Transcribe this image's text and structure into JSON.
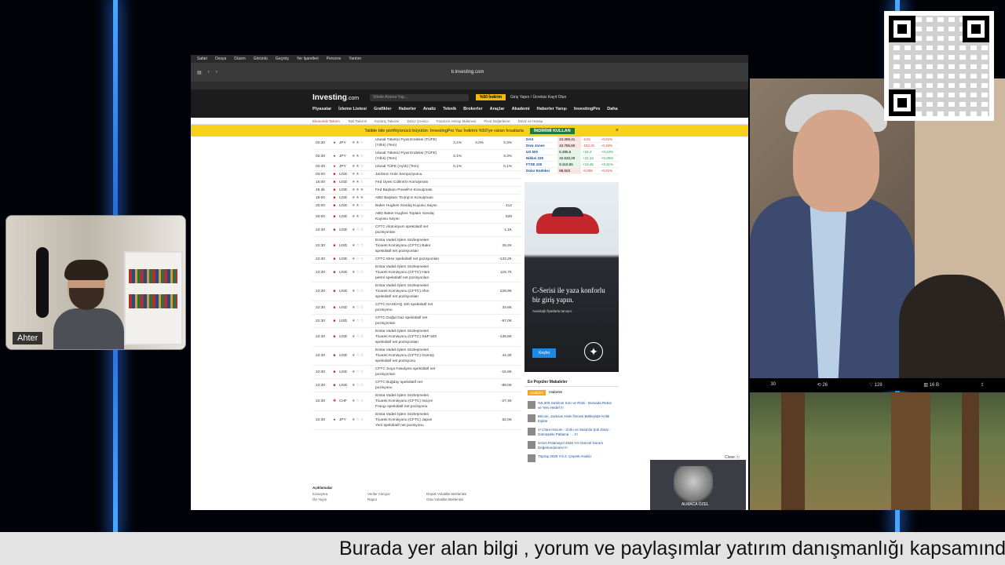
{
  "browser": {
    "url": "tr.investing.com",
    "menubar": [
      "Safari",
      "Dosya",
      "Düzen",
      "Görüntü",
      "Geçmiş",
      "Yer İşaretleri",
      "Pencere",
      "Yardım"
    ]
  },
  "site": {
    "logo": "Investing",
    "logo_suffix": ".com",
    "search_placeholder": "Sitede Arama Yap...",
    "promo_label": "%50 İndirim",
    "login_label": "Giriş Yapın / Ücretsiz Kayıt Olun",
    "nav": [
      "Piyasalar",
      "İzleme Listesi",
      "Grafikler",
      "Haberler",
      "Analiz",
      "Teknik",
      "Brokerler",
      "Araçlar",
      "Akademi",
      "Haberler Yarışı",
      "InvestingPro",
      "Daha"
    ],
    "subnav": [
      "Ekonomik Takvim",
      "Tatil Takvimi",
      "Kazanç Takvimi",
      "Döviz Çevirici",
      "Faizsizin Hesap Makinesi",
      "Pivot Değerleme",
      "Döviz ve Hesap"
    ]
  },
  "banner": {
    "text": "Tatilde bile portföyünüzü büyütün: InvestingPro Yaz İndirimi %50'ye varan fırsatlarla",
    "cta": "İNDİRİMİ KULLAN",
    "close": "×"
  },
  "calendar": [
    {
      "time": "02:30",
      "flag": "●",
      "cur": "JPY",
      "stars": "★★☆",
      "event": "Ulusal Tüketici Fiyat Endeksi (TÜFE) (Yıllık) (Tem)",
      "actual": "3,1%",
      "forecast": "3,0%",
      "prev": "3,3%"
    },
    {
      "time": "02:30",
      "flag": "●",
      "cur": "JPY",
      "stars": "★★☆",
      "event": "Ulusal Tüketici Fiyat Endeksi (TÜFE) (Yıllık) (Tem)",
      "actual": "3,1%",
      "forecast": "",
      "prev": "3,3%"
    },
    {
      "time": "02:30",
      "flag": "●",
      "cur": "JPY",
      "stars": "★★☆",
      "event": "Ulusal TÜFE (Aylık) (Tem)",
      "actual": "0,1%",
      "forecast": "",
      "prev": "0,1%"
    },
    {
      "time": "03:00",
      "flag": "■",
      "cur": "USD",
      "stars": "★★☆",
      "event": "Jackson Hole Sempozyumu",
      "actual": "",
      "forecast": "",
      "prev": ""
    },
    {
      "time": "16:00",
      "flag": "■",
      "cur": "USD",
      "stars": "★★☆",
      "event": "Fed Üyesi Collins'in Konuşması",
      "actual": "",
      "forecast": "",
      "prev": ""
    },
    {
      "time": "45 dk",
      "flag": "■",
      "cur": "USD",
      "stars": "★★★",
      "event": "Fed Başkanı Powell'ın Konuşması",
      "actual": "",
      "forecast": "",
      "prev": ""
    },
    {
      "time": "19:00",
      "flag": "■",
      "cur": "USD",
      "stars": "★★★",
      "event": "ABD Başkanı Trump'ın Konuşması",
      "actual": "",
      "forecast": "",
      "prev": ""
    },
    {
      "time": "20:00",
      "flag": "■",
      "cur": "USD",
      "stars": "★★☆",
      "event": "Baker Hughes Sondaj Kuyusu Sayısı",
      "actual": "",
      "forecast": "",
      "prev": "412"
    },
    {
      "time": "20:00",
      "flag": "■",
      "cur": "USD",
      "stars": "★★☆",
      "event": "ABD Baker Hughes Toplam Sondaj Kuyusu Sayısı",
      "actual": "",
      "forecast": "",
      "prev": "539"
    },
    {
      "time": "22:30",
      "flag": "■",
      "cur": "USD",
      "stars": "★☆☆",
      "event": "CFTC Alüminyum spekülatif net pozisyonları",
      "actual": "",
      "forecast": "",
      "prev": "1,1K"
    },
    {
      "time": "22:30",
      "flag": "■",
      "cur": "USD",
      "stars": "★☆☆",
      "event": "Emtia Vadeli İşlem Sözleşmeleri Ticareti Komisyonu (CFTC) Bakır spekülatif net pozisyonları",
      "actual": "",
      "forecast": "",
      "prev": "26,2K"
    },
    {
      "time": "22:30",
      "flag": "■",
      "cur": "USD",
      "stars": "★☆☆",
      "event": "CFTC Mısır spekülatif net pozisyonları",
      "actual": "",
      "forecast": "",
      "prev": "-133,2K"
    },
    {
      "time": "22:30",
      "flag": "■",
      "cur": "USD",
      "stars": "★☆☆",
      "event": "Emtia Vadeli İşlem Sözleşmeleri Ticareti Komisyonu (CFTC) Ham petrol spekülatif net pozisyonları",
      "actual": "",
      "forecast": "",
      "prev": "116,7K"
    },
    {
      "time": "22:30",
      "flag": "■",
      "cur": "USD",
      "stars": "★☆☆",
      "event": "Emtia Vadeli İşlem Sözleşmeleri Ticareti Komisyonu (CFTC) Altın spekülatif net pozisyonları",
      "actual": "",
      "forecast": "",
      "prev": "229,9K"
    },
    {
      "time": "22:30",
      "flag": "■",
      "cur": "USD",
      "stars": "★☆☆",
      "event": "CFTC NASDAQ 100 spekülatif net pozisyonu",
      "actual": "",
      "forecast": "",
      "prev": "33,8K"
    },
    {
      "time": "22:30",
      "flag": "■",
      "cur": "USD",
      "stars": "★☆☆",
      "event": "CFTC Doğal Gaz spekülatif net pozisyonları",
      "actual": "",
      "forecast": "",
      "prev": "-97,0K"
    },
    {
      "time": "22:30",
      "flag": "■",
      "cur": "USD",
      "stars": "★☆☆",
      "event": "Emtia Vadeli İşlem Sözleşmeleri Ticareti Komisyonu (CFTC) S&P 500 spekülatif net pozisyonları",
      "actual": "",
      "forecast": "",
      "prev": "-138,6K"
    },
    {
      "time": "22:30",
      "flag": "■",
      "cur": "USD",
      "stars": "★☆☆",
      "event": "Emtia Vadeli İşlem Sözleşmeleri Ticareti Komisyonu (CFTC) Gümüş spekülatif net pozisyonu",
      "actual": "",
      "forecast": "",
      "prev": "44,3K"
    },
    {
      "time": "22:30",
      "flag": "■",
      "cur": "USD",
      "stars": "★☆☆",
      "event": "CFTC Soya Fasulyesi spekülatif net pozisyonları",
      "actual": "",
      "forecast": "",
      "prev": "-15,8K"
    },
    {
      "time": "22:30",
      "flag": "■",
      "cur": "USD",
      "stars": "★☆☆",
      "event": "CFTC Buğday spekülatif net pozisyonu",
      "actual": "",
      "forecast": "",
      "prev": "-89,0K"
    },
    {
      "time": "22:30",
      "flag": "✚",
      "cur": "CHF",
      "stars": "★☆☆",
      "event": "Emtia Vadeli İşlem Sözleşmeleri Ticareti Komisyonu (CFTC) İsviçre Frangı spekülatif net pozisyonu",
      "actual": "",
      "forecast": "",
      "prev": "-27,4K"
    },
    {
      "time": "22:30",
      "flag": "●",
      "cur": "JPY",
      "stars": "★☆☆",
      "event": "Emtia Vadeli İşlem Sözleşmeleri Ticareti Komisyonu (CFTC) Japon Yeni spekülatif net pozisyonu",
      "actual": "",
      "forecast": "",
      "prev": "62,0K"
    }
  ],
  "legend": {
    "title": "Açıklamalar",
    "items": [
      "Konuşma",
      "Veriler Alınıyor",
      "Düşük Volatilite Beklentisi",
      "Ön Yayın",
      "Rapor",
      "Orta Volatilite Beklentisi"
    ]
  },
  "markets": [
    {
      "name": "DAX",
      "price": "24.289,41",
      "change": "-2,61",
      "pct": "-0,01%",
      "dir": "down"
    },
    {
      "name": "Dow Jones",
      "price": "44.785,50",
      "change": "-152,31",
      "pct": "-0,34%",
      "dir": "down"
    },
    {
      "name": "US 500",
      "price": "6.385,6",
      "change": "+15,4",
      "pct": "+0,24%",
      "dir": "up"
    },
    {
      "name": "Nikkei 225",
      "price": "42.633,29",
      "change": "+22,12",
      "pct": "+0,05%",
      "dir": "up"
    },
    {
      "name": "FTSE 100",
      "price": "9.319,65",
      "change": "+10,45",
      "pct": "+0,11%",
      "dir": "up"
    },
    {
      "name": "Dolar Endeksi",
      "price": "98,503",
      "change": "-0,006",
      "pct": "-0,01%",
      "dir": "down"
    }
  ],
  "ad": {
    "headline": "C-Serisi ile yaza konforlu bir giriş yapın.",
    "sub": "Avantajlı fiyatlarla tanışın.",
    "cta": "Keşfet",
    "logo": "✦"
  },
  "popular": {
    "title": "En Popüler Makaleler",
    "tabs": [
      "Analizler",
      "Haberler"
    ],
    "items": [
      "%5.300 Getirinin Sırrı ve Riski - Borsada Rekor ve Yeni Hedef !!!",
      "Bitcoin, Jackson Hole Öncesi Bekleyişte Kritik Eşikte",
      "1+1'lara Hücum - Zorlu ve Sasa'da Şok Zarar - Gümüşteki Patlama - ...!!!",
      "SASA Potansiyel 2025 Yılı Güncel Durum Değerlendirmesi !!!",
      "Tüpraş 2025 Yılı 2. Çeyrek Analizi"
    ]
  },
  "video_ad": {
    "close": "Close ⓧ",
    "caption": "ALMACA ÖZEL"
  },
  "webcam": {
    "name": "Ahter"
  },
  "tweet_stats": [
    "30",
    "⟲ 26",
    "♡ 128",
    "▥ 16 B",
    "⇪"
  ],
  "ticker": "Burada yer alan bilgi , yorum ve paylaşımlar yatırım danışmanlığı kapsamında değildir."
}
